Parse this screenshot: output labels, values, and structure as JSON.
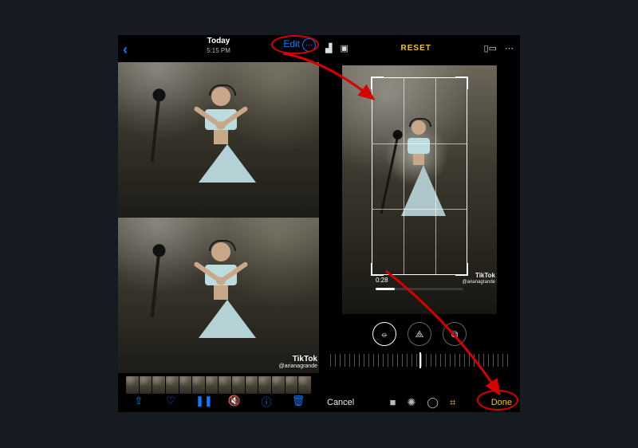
{
  "left": {
    "title": "Today",
    "subtitle": "5:15 PM",
    "edit": "Edit",
    "more": "⋯",
    "tiktok_logo": "TikTok",
    "tiktok_user": "@arianagrande",
    "toolbar": {
      "share": "⇪",
      "favorite": "♡",
      "pause": "❚❚",
      "mute": "🔇",
      "info": "ⓘ",
      "trash": "🗑"
    }
  },
  "right": {
    "reset": "RESET",
    "playtime": "0:28",
    "tiktok_logo": "TikTok",
    "tiktok_user": "@arianagrande",
    "straighten": "⦵",
    "vertical": "⟁",
    "horizontal": "⧉",
    "bottom": {
      "cancel": "Cancel",
      "video": "■",
      "adjust": "✺",
      "filters": "◯",
      "crop": "⌗",
      "done": "Done"
    },
    "top_icons": {
      "flip": "▟",
      "rotate": "▣",
      "aspect": "▯▭",
      "more": "⋯"
    }
  }
}
